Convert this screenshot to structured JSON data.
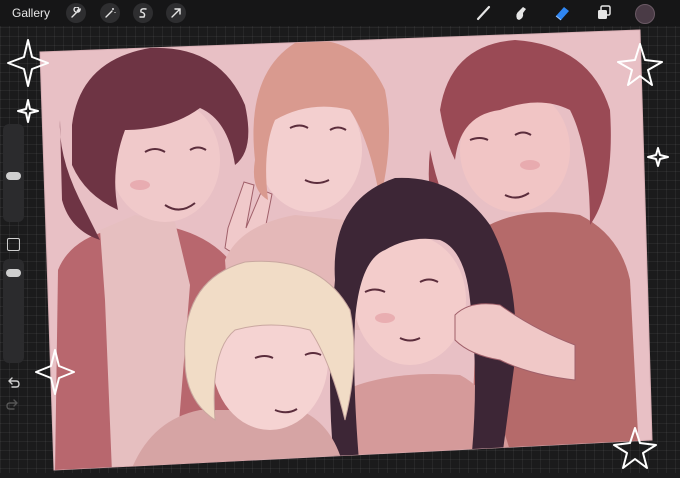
{
  "app": {
    "gallery_label": "Gallery",
    "left_tools": [
      "wrench-icon",
      "magic-wand-icon",
      "selection-s-icon",
      "transform-arrow-icon"
    ],
    "right_tools": [
      "brush-icon",
      "smudge-icon",
      "eraser-icon",
      "layers-icon"
    ],
    "active_tool": "eraser-icon",
    "current_color": "#4a3b46",
    "accent_color": "#2f86f2"
  },
  "canvas": {
    "background": "#e9c4c8",
    "description_colors": [
      "#f2c9cd",
      "#7b3f4c",
      "#5b2d3c",
      "#3a2836"
    ]
  }
}
